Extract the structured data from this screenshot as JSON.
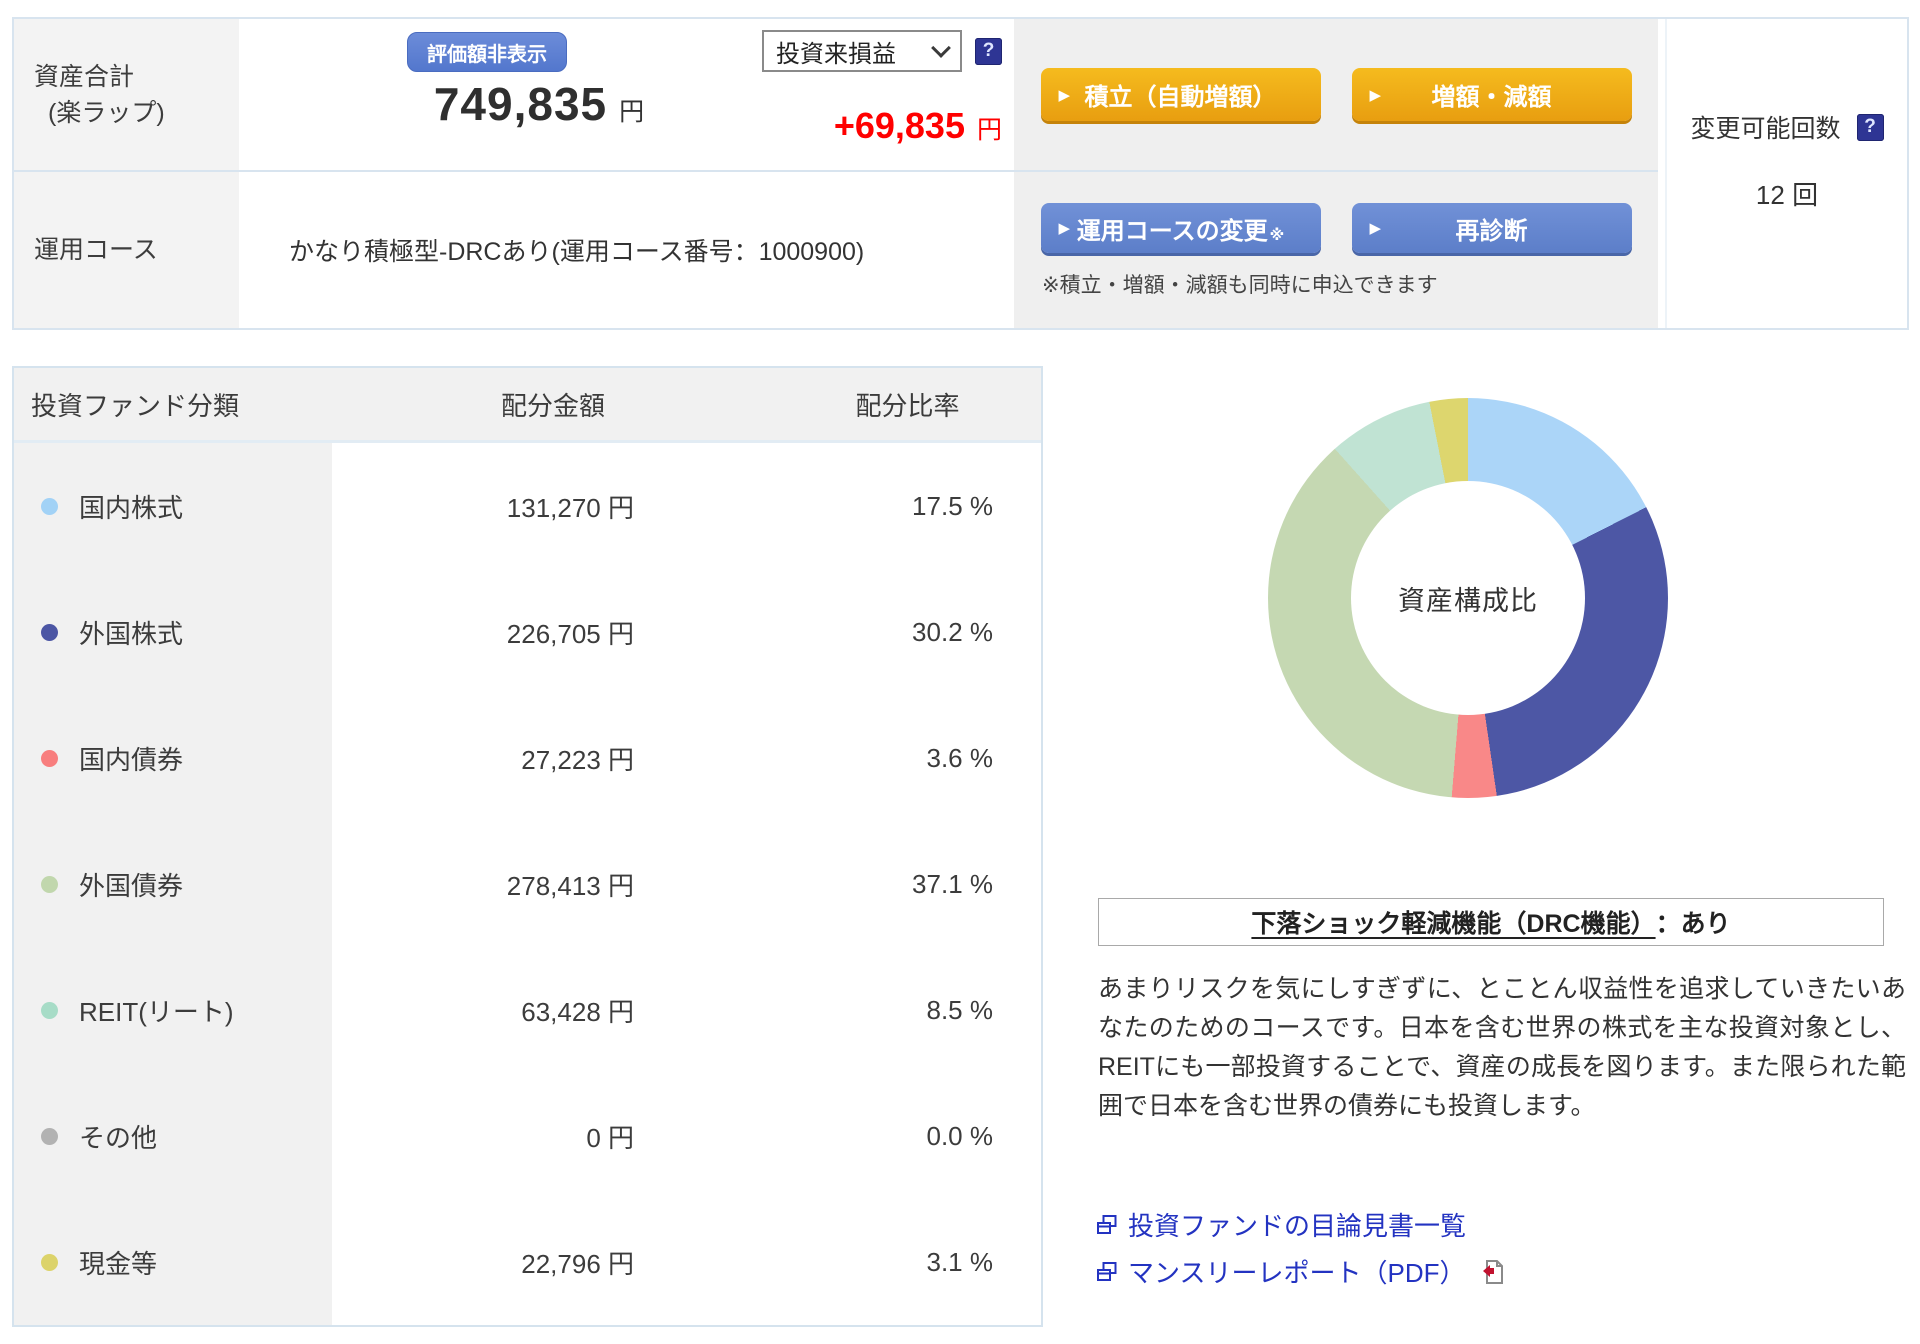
{
  "top": {
    "asset_label_line1": "資産合計",
    "asset_label_line2": "(楽ラップ)",
    "hide_valuation_button": "評価額非表示",
    "total_amount": "749,835",
    "yen_unit": "円",
    "pl_select_value": "投資来損益",
    "pl_amount": "+69,835",
    "tsumitate_button": "積立（自動増額）",
    "increase_decrease_button": "増額・減額",
    "course_label": "運用コース",
    "course_value": "かなり積極型-DRCあり(運用コース番号：1000900)",
    "course_change_button": "運用コースの変更",
    "course_change_mark": "※",
    "rediagnose_button": "再診断",
    "simultaneous_note": "※積立・増額・減額も同時に申込できます",
    "change_count_label": "変更可能回数",
    "change_count_value": "12 回"
  },
  "allocation_table": {
    "headers": [
      "投資ファンド分類",
      "配分金額",
      "配分比率"
    ],
    "rows": [
      {
        "label": "国内株式",
        "color": "#a2d2f6",
        "amount": "131,270 円",
        "ratio": "17.5 %"
      },
      {
        "label": "外国株式",
        "color": "#4c56a4",
        "amount": "226,705 円",
        "ratio": "30.2 %"
      },
      {
        "label": "国内債券",
        "color": "#f87e7e",
        "amount": "27,223 円",
        "ratio": "3.6 %"
      },
      {
        "label": "外国債券",
        "color": "#c1d7ad",
        "amount": "278,413 円",
        "ratio": "37.1 %"
      },
      {
        "label": "REIT(リート)",
        "color": "#a7dcc7",
        "amount": "63,428 円",
        "ratio": "8.5 %"
      },
      {
        "label": "その他",
        "color": "#b2b2b2",
        "amount": "0 円",
        "ratio": "0.0 %"
      },
      {
        "label": "現金等",
        "color": "#dcd36a",
        "amount": "22,796 円",
        "ratio": "3.1 %"
      }
    ]
  },
  "chart_data": {
    "type": "pie",
    "donut": true,
    "center_label": "資産構成比",
    "categories": [
      "国内株式",
      "外国株式",
      "国内債券",
      "外国債券",
      "REIT(リート)",
      "その他",
      "現金等"
    ],
    "values": [
      17.5,
      30.2,
      3.6,
      37.1,
      8.5,
      0.0,
      3.1
    ],
    "amounts_yen": [
      131270,
      226705,
      27223,
      278413,
      63428,
      0,
      22796
    ],
    "colors": [
      "#abd5f8",
      "#4d57a5",
      "#f98888",
      "#c5d8b2",
      "#c0e3d3",
      "#b2b2b2",
      "#ddd66e"
    ],
    "start_angle_deg": 0,
    "direction": "clockwise",
    "legend_position": "none"
  },
  "drc": {
    "heading_underlined": "下落ショック軽減機能（DRC機能）",
    "heading_suffix": "：あり",
    "description": "あまりリスクを気にしすぎずに、とことん収益性を追求していきたいあなたのためのコースです。日本を含む世界の株式を主な投資対象とし、REITにも一部投資することで、資産の成長を図ります。また限られた範囲で日本を含む世界の債券にも投資します。"
  },
  "links": [
    {
      "label": "投資ファンドの目論見書一覧",
      "icon": "external-link-icon"
    },
    {
      "label": "マンスリーレポート（PDF）",
      "icon": "external-link-icon",
      "trailing_icon": "pdf-icon"
    }
  ]
}
